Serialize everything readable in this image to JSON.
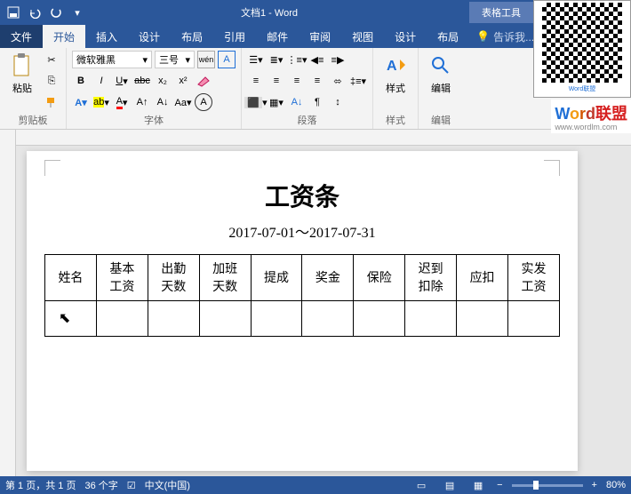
{
  "window": {
    "title": "文档1 - Word",
    "tableTools": "表格工具"
  },
  "qat": {
    "save": "💾",
    "undo": "↶",
    "redo": "↻"
  },
  "tabs": [
    "文件",
    "开始",
    "插入",
    "设计",
    "布局",
    "引用",
    "邮件",
    "审阅",
    "视图",
    "设计",
    "布局"
  ],
  "tell": "告诉我...",
  "ribbon": {
    "clipboard": {
      "label": "剪贴板",
      "paste": "粘贴"
    },
    "font": {
      "label": "字体",
      "name": "微软雅黑",
      "size": "三号"
    },
    "paragraph": {
      "label": "段落"
    },
    "styles": {
      "label": "样式",
      "btn": "样式"
    },
    "editing": {
      "label": "编辑",
      "btn": "编辑"
    }
  },
  "document": {
    "title": "工资条",
    "subtitle": "2017-07-01～2017-07-31",
    "headers": [
      "姓名",
      "基本\n工资",
      "出勤\n天数",
      "加班\n天数",
      "提成",
      "奖金",
      "保险",
      "迟到\n扣除",
      "应扣",
      "实发\n工资"
    ]
  },
  "status": {
    "page": "第 1 页，共 1 页",
    "words": "36 个字",
    "lang": "中文(中国)",
    "zoom": "80%"
  },
  "brand": {
    "url": "www.wordlm.com"
  }
}
